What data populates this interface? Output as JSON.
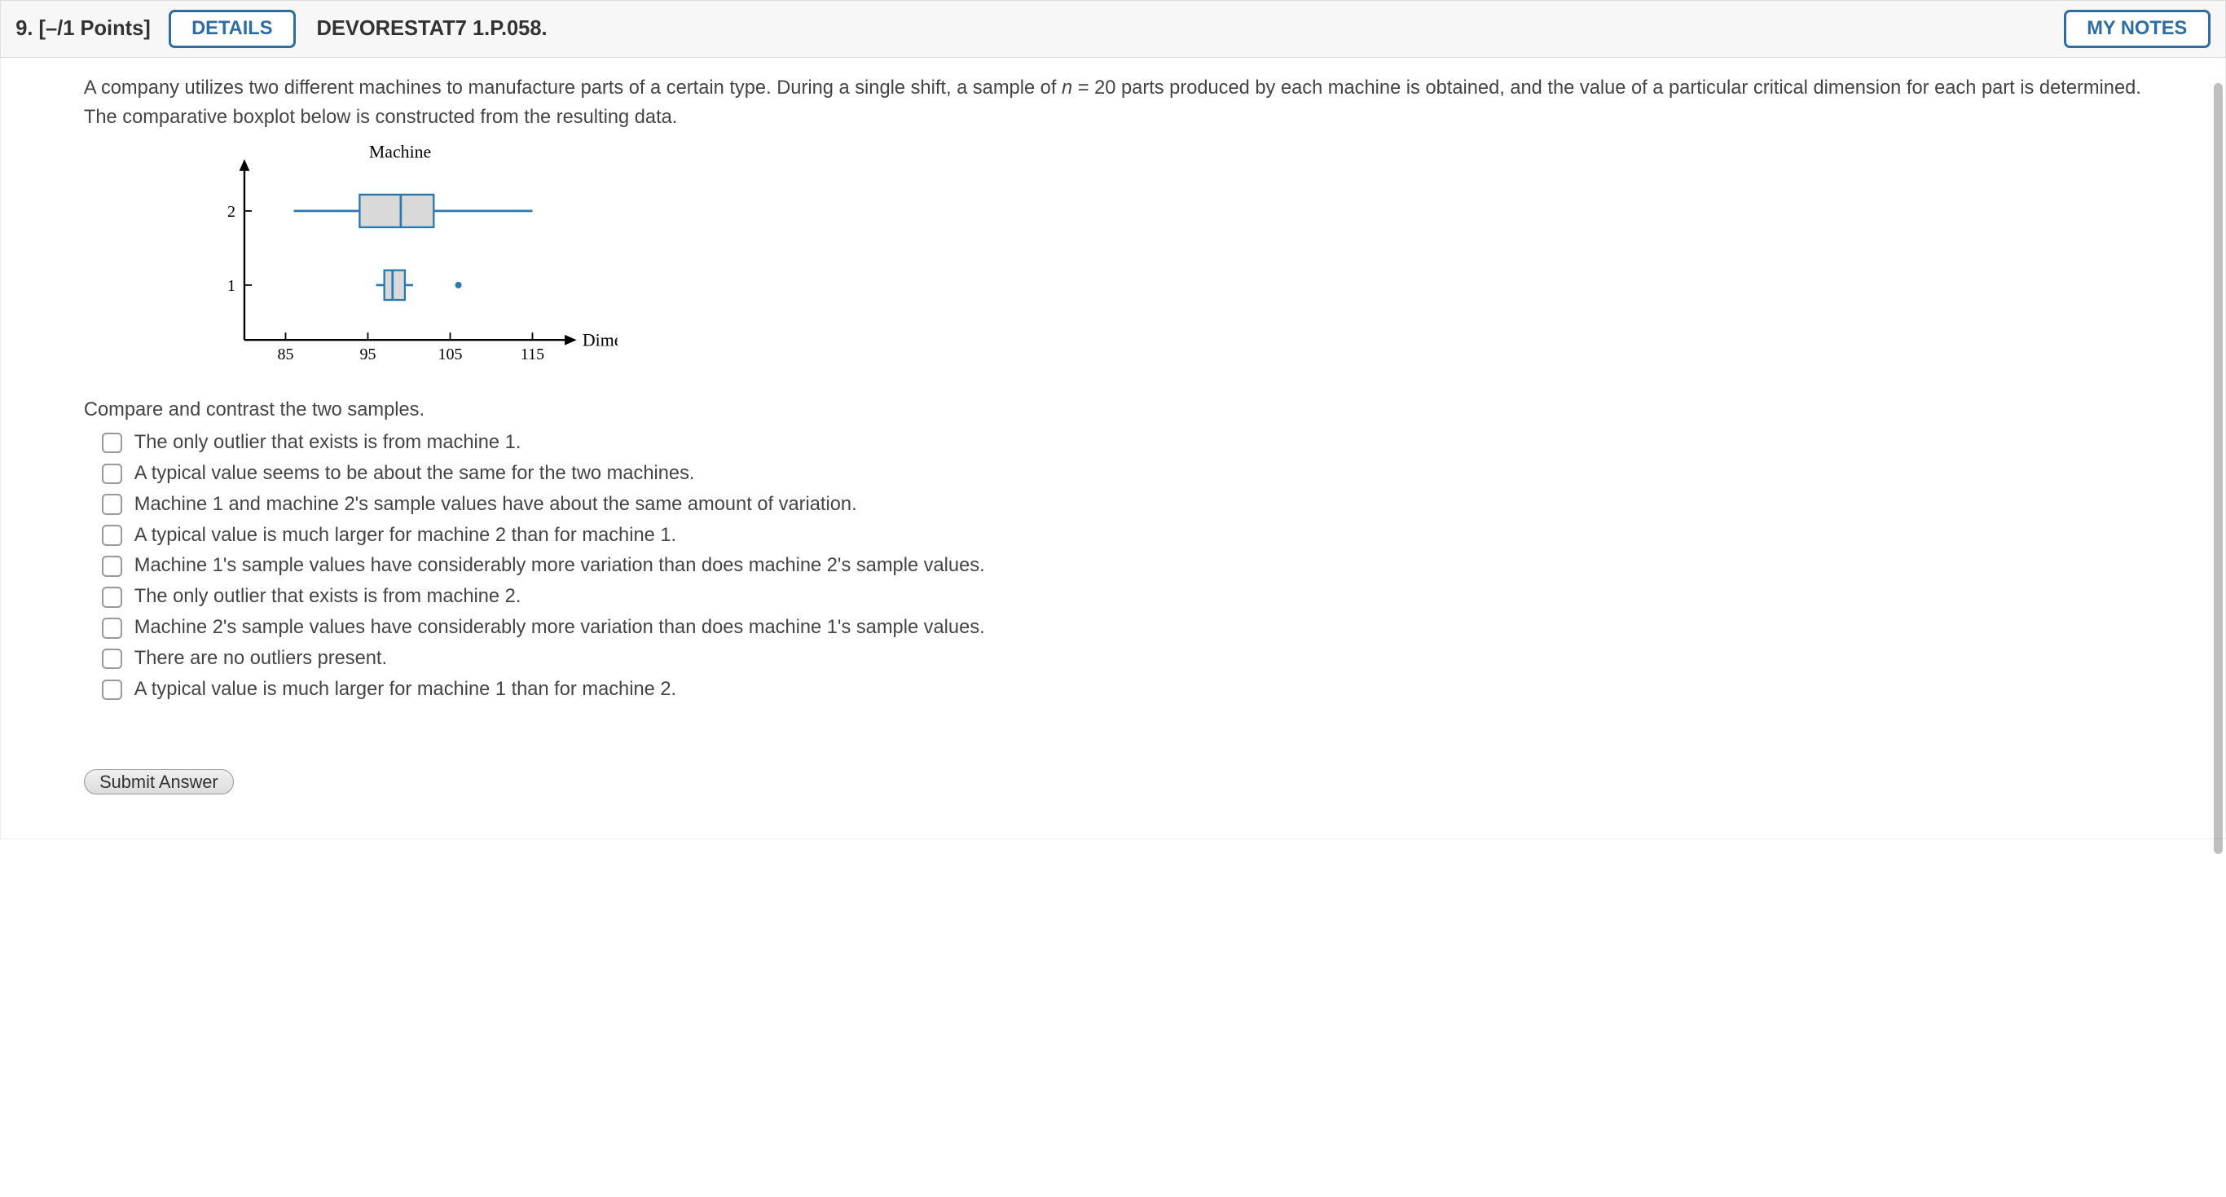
{
  "header": {
    "question_number": "9.",
    "points": "[–/1 Points]",
    "details_label": "DETAILS",
    "assignment_code": "DEVORESTAT7 1.P.058.",
    "mynotes_label": "MY NOTES"
  },
  "prompt_pre_n": "A company utilizes two different machines to manufacture parts of a certain type. During a single shift, a sample of ",
  "prompt_n": "n",
  "prompt_post_n": " = 20 parts produced by each machine is obtained, and the value of a particular critical dimension for each part is determined. The comparative boxplot below is constructed from the resulting data.",
  "instruction": "Compare and contrast the two samples.",
  "options": [
    "The only outlier that exists is from machine 1.",
    "A typical value seems to be about the same for the two machines.",
    "Machine 1 and machine 2's sample values have about the same amount of variation.",
    "A typical value is much larger for machine 2 than for machine 1.",
    "Machine 1's sample values have considerably more variation than does machine 2's sample values.",
    "The only outlier that exists is from machine 2.",
    "Machine 2's sample values have considerably more variation than does machine 1's sample values.",
    "There are no outliers present.",
    "A typical value is much larger for machine 1 than for machine 2."
  ],
  "submit_label": "Submit Answer",
  "chart_data": {
    "type": "boxplot",
    "title": "",
    "xlabel": "Dimension",
    "ylabel": "Machine",
    "x_ticks": [
      85,
      95,
      105,
      115
    ],
    "xlim": [
      80,
      120
    ],
    "y_categories": [
      "1",
      "2"
    ],
    "series": [
      {
        "name": "Machine 2",
        "y": 2,
        "min": 86,
        "q1": 94,
        "median": 99,
        "q3": 103,
        "max": 115,
        "outliers": []
      },
      {
        "name": "Machine 1",
        "y": 1,
        "min": 96,
        "q1": 97,
        "median": 98,
        "q3": 99.5,
        "max": 100.5,
        "outliers": [
          106
        ]
      }
    ]
  }
}
